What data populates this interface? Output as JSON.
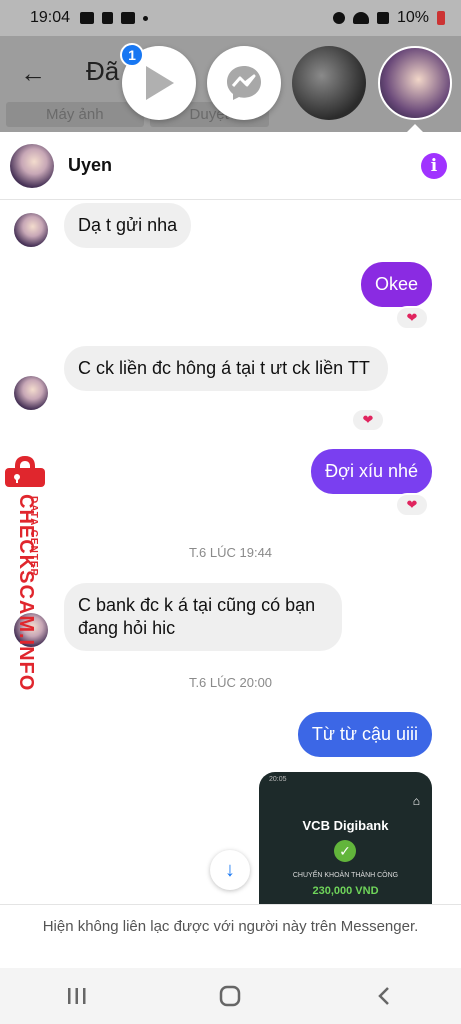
{
  "status_bar": {
    "time": "19:04",
    "battery": "10%"
  },
  "background_app": {
    "title": "Đã  1",
    "tabs": [
      "Máy ảnh",
      "Duyệt"
    ]
  },
  "chat_heads": {
    "badge_count": "1"
  },
  "chat": {
    "contact_name": "Uyen",
    "messages": [
      {
        "direction": "in",
        "text": "Dạ t gửi nha"
      },
      {
        "direction": "out",
        "text": "Okee",
        "reaction": "❤"
      },
      {
        "direction": "in",
        "text": "C ck liền đc hông á tại t ưt ck liền TT",
        "reaction": "❤"
      },
      {
        "direction": "out",
        "text": "Đợi xíu nhé",
        "reaction": "❤"
      },
      {
        "direction": "in",
        "text": "C bank đc k á tại cũng có bạn đang hỏi hic"
      },
      {
        "direction": "out",
        "text": "Từ từ cậu uiii"
      }
    ],
    "timestamps": [
      "T.6 LÚC 19:44",
      "T.6 LÚC 20:00"
    ],
    "attachment": {
      "status": "20:05",
      "bank_logo": "VCB Digibank",
      "caption": "CHUYỂN KHOẢN THÀNH CÔNG",
      "amount": "230,000 VND"
    },
    "footer_notice": "Hiện không liên lạc được với người này trên Messenger."
  },
  "watermark": {
    "text": "CHECKSCAM.INFO",
    "sub": "DATA CENTER"
  },
  "colors": {
    "accent": "#a033ff",
    "out_bubble_top": "#8a2be2",
    "out_bubble_bottom": "#3c67e6",
    "watermark": "#e0262d"
  },
  "icons": [
    "back-arrow-icon",
    "play-icon",
    "messenger-icon",
    "info-icon",
    "heart-icon",
    "scroll-down-icon",
    "lock-icon",
    "recents-icon",
    "home-icon",
    "back-icon"
  ]
}
